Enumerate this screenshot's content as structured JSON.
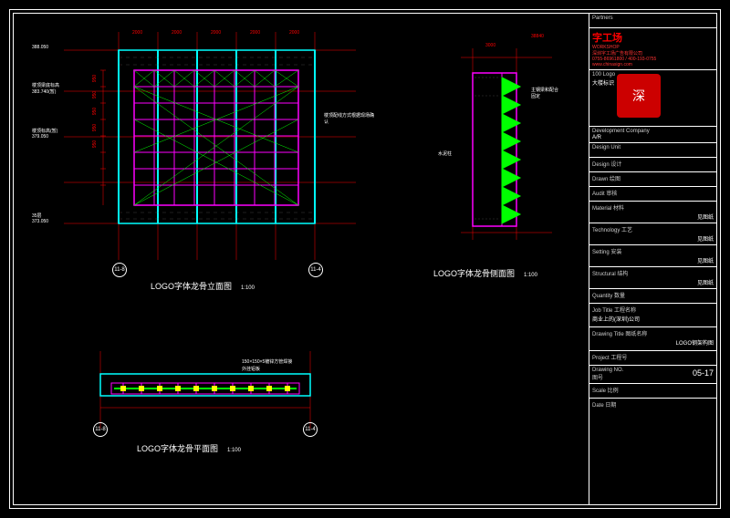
{
  "views": {
    "elevation": {
      "title": "LOGO字体龙骨立面图",
      "scale": "1:100"
    },
    "section": {
      "title": "LOGO字体龙骨侧面图",
      "scale": "1:100"
    },
    "plan": {
      "title": "LOGO字体龙骨平面图",
      "scale": "1:100"
    }
  },
  "markers": {
    "m1": "11-8",
    "m2": "11-4"
  },
  "elevations": {
    "lv1": "388.050",
    "lv2_label": "楼顶梁底标高",
    "lv2": "383.740(暂)",
    "lv3_label": "楼顶标高(暂)",
    "lv3": "379.050",
    "lv4_label": "35层",
    "lv4": "373.050"
  },
  "dims": {
    "col_spacing": "2000",
    "row_spacing": "950",
    "sect_w": "3000",
    "plan_dim": "38840"
  },
  "notes": {
    "n1": "楼顶配线方式根据现场确认",
    "n2": "主钢梁和配合固定",
    "n3": "水泥柱",
    "n4": "150×150×5镀锌方管焊接",
    "n5": "外挂铝板"
  },
  "titleblock": {
    "brand": "字工场",
    "brand_en": "WORKSHOP",
    "contact1": "深圳字工场广告有限公司",
    "contact2": "0755-86961800 / 400-193-0755",
    "contact3": "www.chinasign.com",
    "seal_text": "深",
    "logo_label": "100 Logo",
    "logo_value": "大楼标识",
    "dev_label": "Development Company",
    "dev_value": "A/R",
    "design_unit_label": "Design Unit",
    "design_label": "Design 设计",
    "drawn_label": "Drawn 绘图",
    "audit_label": "Audit 审核",
    "material_label": "Material 材料",
    "material_value": "见图纸",
    "tech_label": "Technology 工艺",
    "tech_value": "见图纸",
    "setting_label": "Setting 安装",
    "setting_value": "见图纸",
    "struct_label": "Structural 结构",
    "struct_value": "见图纸",
    "qty_label": "Quantity 数量",
    "jobtitle_label": "Job Title 工程名称",
    "jobtitle_value": "商业上的(深圳)公司",
    "dwgtitle_label": "Drawing Title 图纸名称",
    "dwgtitle_value": "LOGO钢架构图",
    "project_label": "Project 工程号",
    "dwgno_label": "Drawing NO.",
    "dwgno_sub": "图号",
    "dwgno_value": "05-17",
    "scale_label": "Scale 比例",
    "date_label": "Date 日期"
  },
  "partner_label": "Partners"
}
